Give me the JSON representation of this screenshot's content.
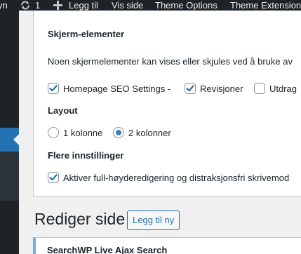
{
  "admin_bar": {
    "site_name_fragment": "yn",
    "updates_count": "1",
    "new_label": "Legg til",
    "view_label": "Vis side",
    "theme_options_label": "Theme Options",
    "theme_extensions_label": "Theme Extension"
  },
  "screen_options": {
    "elements_heading": "Skjerm-elementer",
    "elements_description": "Noen skjermelementer kan vises eller skjules ved å bruke av",
    "boxes": [
      {
        "label": "Homepage SEO Settings -",
        "checked": true
      },
      {
        "label": "Revisjoner",
        "checked": true
      },
      {
        "label": "Utdrag",
        "checked": false
      }
    ],
    "layout_heading": "Layout",
    "layout_options": [
      {
        "label": "1 kolonne",
        "selected": false
      },
      {
        "label": "2 kolonner",
        "selected": true
      }
    ],
    "more_heading": "Flere innstillinger",
    "fullheight_label": "Aktiver full-høyderedigering og distraksjonsfri skrivemod",
    "fullheight_checked": true
  },
  "page": {
    "title": "Rediger side",
    "add_new_label": "Legg til ny"
  },
  "notice": {
    "title": "SearchWP Live Ajax Search"
  },
  "colors": {
    "admin_bar": "#1d2327",
    "accent": "#2271b1",
    "checkmark": "#2271b1",
    "notice_border": "#72aee6"
  }
}
